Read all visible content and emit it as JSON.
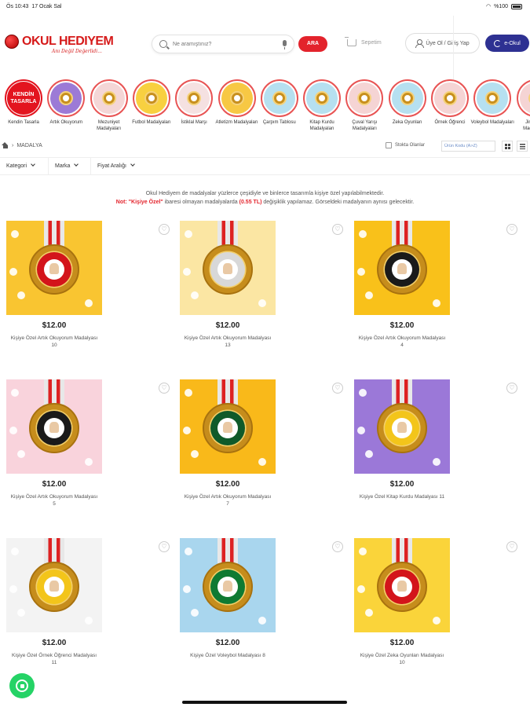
{
  "status": {
    "time": "Ös 10:43",
    "date": "17 Ocak Sal",
    "battery": "%100"
  },
  "header": {
    "brand": "OKUL HEDIYEM",
    "slogan": "Anı Değil Değerlidi...",
    "search_placeholder": "Ne aramıştınız?",
    "search_button": "ARA",
    "cart_label": "Sepetim",
    "login_label": "Üye Ol / Giriş Yap",
    "eokul_label": "e-Okul"
  },
  "categories": [
    {
      "label": "Kendin Tasarla",
      "badge": "KENDİN TASARLA",
      "bg": "#ffffff"
    },
    {
      "label": "Artık Okuyorum",
      "bg": "#9c7ad6"
    },
    {
      "label": "Mezuniyet Madalyaları",
      "bg": "#f4d6d6"
    },
    {
      "label": "Futbol Madalyaları",
      "bg": "#f8d040"
    },
    {
      "label": "İstiklal Marşı",
      "bg": "#f5e1e1"
    },
    {
      "label": "Atletizm Madalyaları",
      "bg": "#f7c844"
    },
    {
      "label": "Çarpım Tablosu",
      "bg": "#b6e0f0"
    },
    {
      "label": "Kitap Kurdu Madalyaları",
      "bg": "#b6e0f0"
    },
    {
      "label": "Çuval Yarışı Madalyaları",
      "bg": "#f5d4d4"
    },
    {
      "label": "Zeka Oyunları",
      "bg": "#b6e0f0"
    },
    {
      "label": "Örnek Öğrenci",
      "bg": "#f5d4d4"
    },
    {
      "label": "Voleybol Madalyaları",
      "bg": "#b6e0f0"
    },
    {
      "label": "Jimnastik Madalyaları",
      "bg": "#f5d4d4"
    }
  ],
  "breadcrumb": {
    "current": "MADALYA"
  },
  "toolbar": {
    "stock_label": "Stokta Olanlar",
    "sort_label": "Ürün Kodu (A>Z)"
  },
  "filters": [
    "Kategori",
    "Marka",
    "Fiyat Aralığı"
  ],
  "info": {
    "line1": "Okul Hediyem de madalyalar yüzlerce çeşidiyle ve binlerce tasarımla kişiye özel yapılabilmektedir.",
    "not_label": "Not:",
    "ozel_label": "\"Kişiye Özel\"",
    "line2a": "ibaresi olmayan madalyalarda",
    "price_note": "(0.55 TL)",
    "line2b": "değişiklik yapılamaz. Görseldeki madalyanın aynısı gelecektir."
  },
  "products": [
    {
      "price": "$12.00",
      "name": "Kişiye Özel Artık Okuyorum Madalyası 10",
      "bg": "#f9c531",
      "ring": "#d3141b"
    },
    {
      "price": "$12.00",
      "name": "Kişiye Özel Artık Okuyorum Madalyası 13",
      "bg": "#fbe6a3",
      "ring": "#d8d8d8"
    },
    {
      "price": "$12.00",
      "name": "Kişiye Özel Artık Okuyorum Madalyası 4",
      "bg": "#f9c11a",
      "ring": "#1a1a1a"
    },
    {
      "price": "$12.00",
      "name": "Kişiye Özel Artık Okuyorum Madalyası 5",
      "bg": "#f9d3dc",
      "ring": "#1a1a1a"
    },
    {
      "price": "$12.00",
      "name": "Kişiye Özel Artık Okuyorum Madalyası 7",
      "bg": "#f9b91a",
      "ring": "#0f5a2a"
    },
    {
      "price": "$12.00",
      "name": "Kişiye Özel Kitap Kurdu Madalyası 11",
      "bg": "#9b78d8",
      "ring": "#f3c51a"
    },
    {
      "price": "$12.00",
      "name": "Kişiye Özel Örnek Öğrenci Madalyası 11",
      "bg": "#f3f3f3",
      "ring": "#f3c51a"
    },
    {
      "price": "$12.00",
      "name": "Kişiye Özel Voleybol Madalyası 8",
      "bg": "#a9d6ee",
      "ring": "#0f7a32"
    },
    {
      "price": "$12.00",
      "name": "Kişiye Özel Zeka Oyunları Madalyası 10",
      "bg": "#fad43a",
      "ring": "#d3141b"
    }
  ]
}
